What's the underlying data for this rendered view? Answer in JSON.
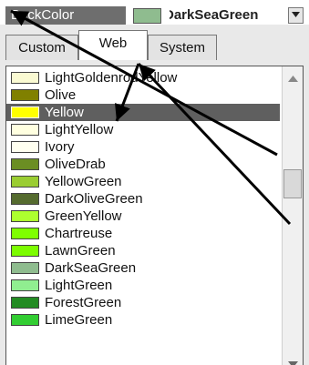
{
  "property": {
    "name": "BackColor",
    "value": "DarkSeaGreen",
    "value_color": "#8FBC8F"
  },
  "tabs": [
    {
      "label": "Custom",
      "active": false
    },
    {
      "label": "Web",
      "active": true
    },
    {
      "label": "System",
      "active": false
    }
  ],
  "colors": [
    {
      "label": "LightGoldenrodYellow",
      "swatch": "#FAFAD2"
    },
    {
      "label": "Olive",
      "swatch": "#808000"
    },
    {
      "label": "Yellow",
      "swatch": "#FFFF00",
      "selected": true
    },
    {
      "label": "LightYellow",
      "swatch": "#FFFFE0"
    },
    {
      "label": "Ivory",
      "swatch": "#FFFFF0"
    },
    {
      "label": "OliveDrab",
      "swatch": "#6B8E23"
    },
    {
      "label": "YellowGreen",
      "swatch": "#9ACD32"
    },
    {
      "label": "DarkOliveGreen",
      "swatch": "#556B2F"
    },
    {
      "label": "GreenYellow",
      "swatch": "#ADFF2F"
    },
    {
      "label": "Chartreuse",
      "swatch": "#7FFF00"
    },
    {
      "label": "LawnGreen",
      "swatch": "#7CFC00"
    },
    {
      "label": "DarkSeaGreen",
      "swatch": "#8FBC8F"
    },
    {
      "label": "LightGreen",
      "swatch": "#90EE90"
    },
    {
      "label": "ForestGreen",
      "swatch": "#228B22"
    },
    {
      "label": "LimeGreen",
      "swatch": "#32CD32"
    }
  ],
  "icons": {
    "dropdown": "chevron-down-icon",
    "scroll_up": "arrow-up-icon",
    "scroll_down": "arrow-down-icon"
  }
}
